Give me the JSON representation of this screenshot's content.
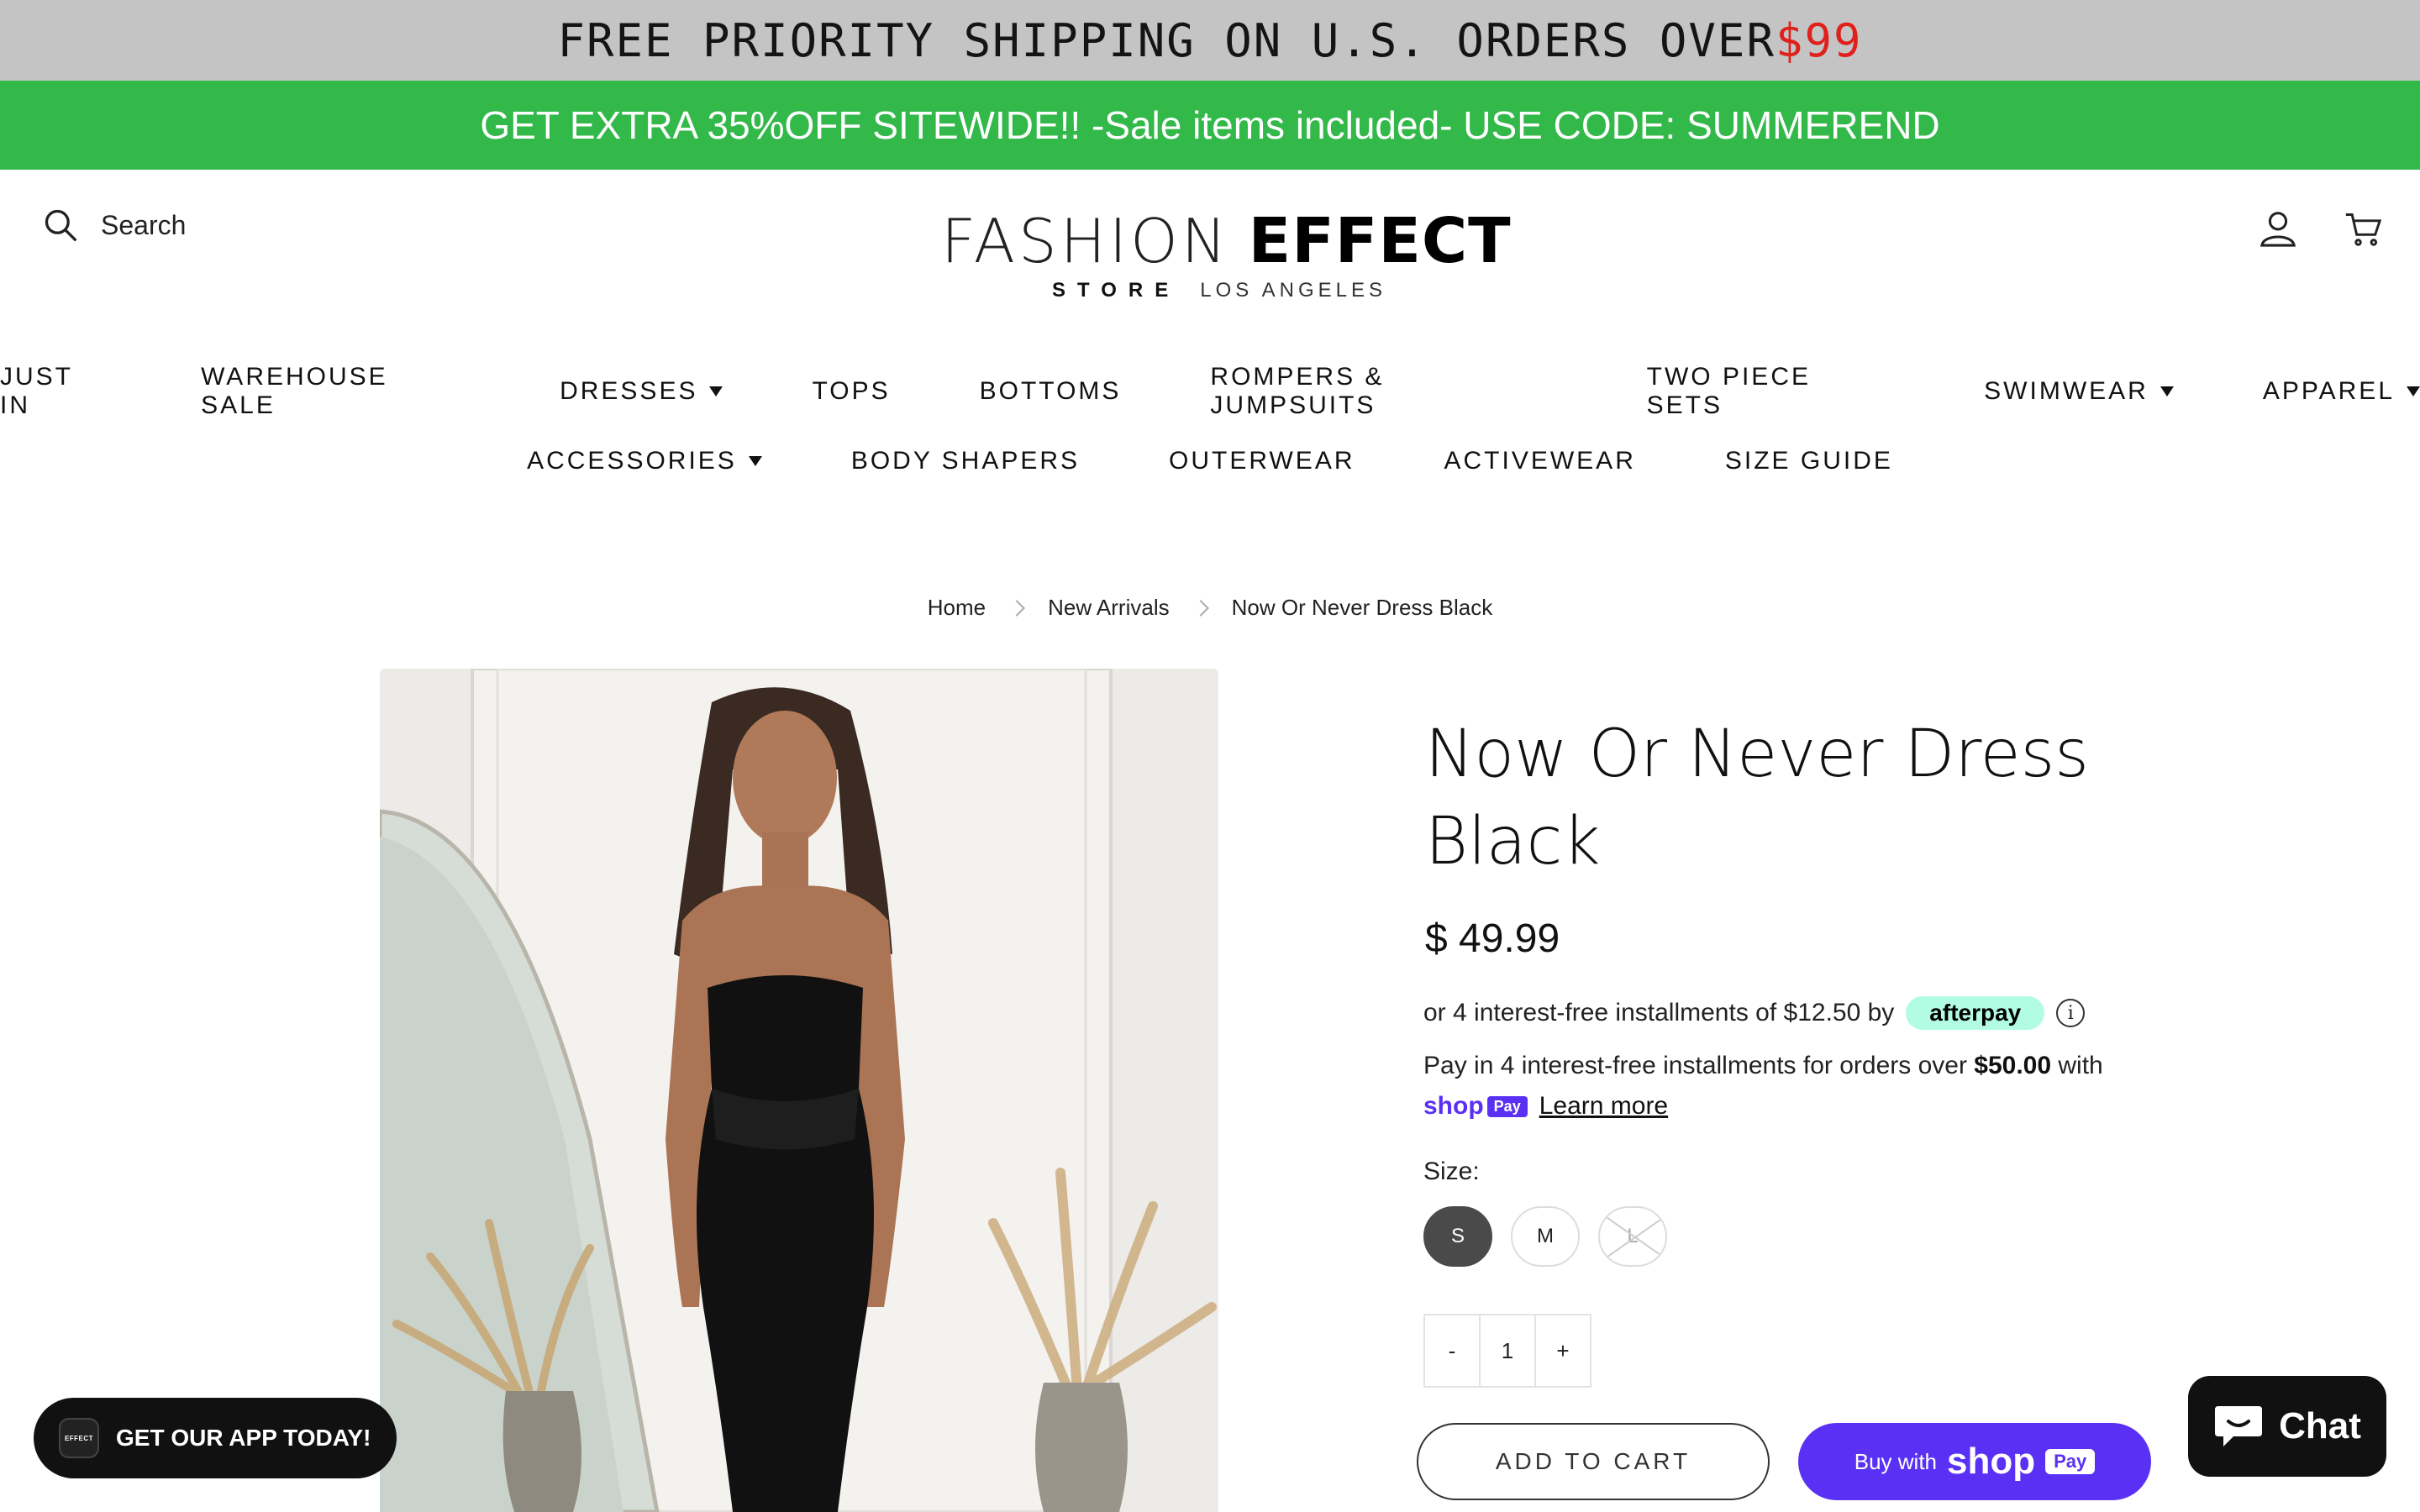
{
  "announcement": {
    "shipping_text": "FREE PRIORITY SHIPPING ON U.S. ORDERS OVER ",
    "shipping_amount": "$99",
    "promo_text": "GET EXTRA 35%OFF SITEWIDE!! -Sale items included- USE CODE: SUMMEREND"
  },
  "header": {
    "search_label": "Search",
    "logo_line1_light": "FASHION",
    "logo_line1_bold": "EFFECT",
    "logo_line2_bold": "STORE",
    "logo_line2_light": "LOS ANGELES"
  },
  "nav": {
    "row1": [
      "JUST IN",
      "WAREHOUSE SALE",
      "DRESSES",
      "TOPS",
      "BOTTOMS",
      "ROMPERS & JUMPSUITS",
      "TWO PIECE SETS",
      "SWIMWEAR",
      "APPAREL"
    ],
    "row2": [
      "ACCESSORIES",
      "BODY SHAPERS",
      "OUTERWEAR",
      "ACTIVEWEAR",
      "SIZE GUIDE"
    ]
  },
  "breadcrumb": [
    "Home",
    "New Arrivals",
    "Now Or Never Dress Black"
  ],
  "product": {
    "title_line1": "Now Or Never Dress",
    "title_line2": "Black",
    "price": "$ 49.99",
    "afterpay_text": "or 4 interest-free installments of $12.50 by",
    "afterpay_brand": "afterpay",
    "info_glyph": "i",
    "shoppay_text": "Pay in 4 interest-free installments for orders over ",
    "shoppay_threshold": "$50.00",
    "shoppay_with": " with",
    "shoppay_brand": "shop",
    "shoppay_pay": "Pay",
    "learn_more": "Learn more",
    "size_label": "Size:",
    "sizes": [
      "S",
      "M",
      "L"
    ],
    "selected_size": "S",
    "unavailable_sizes": [
      "L"
    ],
    "quantity_minus": "-",
    "quantity_value": "1",
    "quantity_plus": "+",
    "add_to_cart": "ADD TO CART",
    "buy_with": "Buy with",
    "buy_shop": "shop",
    "buy_pay": "Pay"
  },
  "app_banner": {
    "text": "GET OUR APP TODAY!",
    "icon_text": "EFFECT"
  },
  "chat": {
    "label": "Chat"
  },
  "colors": {
    "shipping_bar": "#c4c4c4",
    "promo_bar": "#33b84a",
    "accent_red": "#e0201b",
    "shoppay_purple": "#5a31f4",
    "afterpay_mint": "#b2fce4"
  },
  "icons": [
    "search-icon",
    "user-icon",
    "cart-icon",
    "chevron-right-icon",
    "caret-down-icon",
    "info-icon",
    "chat-bubble-icon"
  ]
}
